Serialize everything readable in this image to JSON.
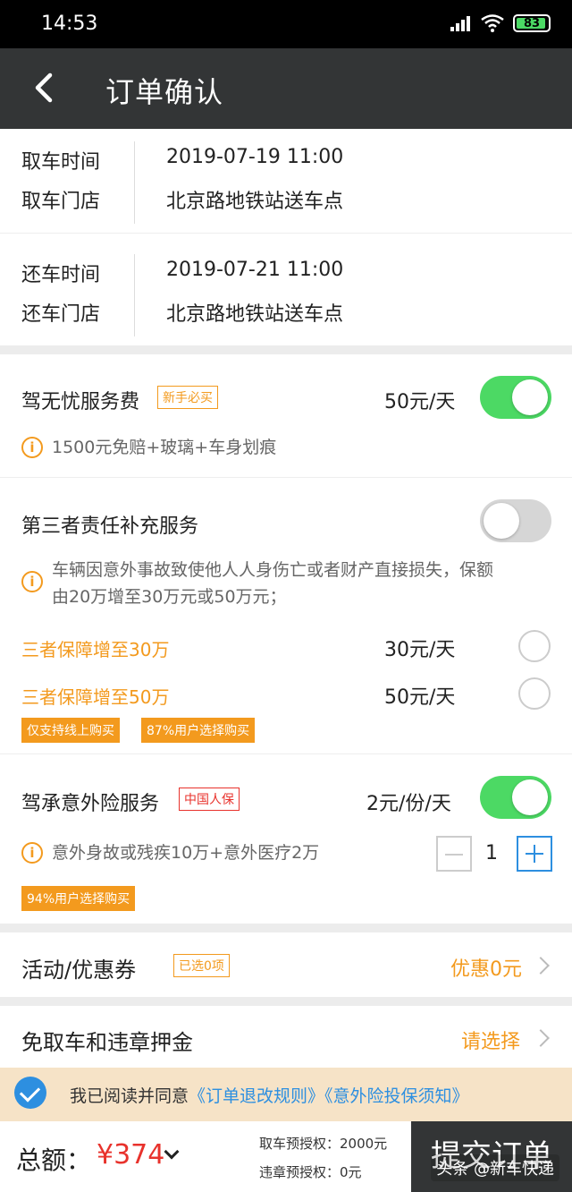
{
  "status_bar": {
    "time": "14:53",
    "battery": "83"
  },
  "nav": {
    "title": "订单确认"
  },
  "pickup": {
    "time_label": "取车时间",
    "time_value": "2019-07-19 11:00",
    "store_label": "取车门店",
    "store_value": "北京路地铁站送车点"
  },
  "return": {
    "time_label": "还车时间",
    "time_value": "2019-07-21 11:00",
    "store_label": "还车门店",
    "store_value": "北京路地铁站送车点"
  },
  "worry_free": {
    "title": "驾无忧服务费",
    "tag": "新手必买",
    "price": "50元/天",
    "enabled": true,
    "note": "1500元免赔+玻璃+车身划痕"
  },
  "third_party": {
    "title": "第三者责任补充服务",
    "enabled": false,
    "note_line1": "车辆因意外事故致使他人人身伤亡或者财产直接损失，保额",
    "note_line2": "由20万增至30万元或50万元；",
    "options": [
      {
        "label": "三者保障增至30万",
        "price": "30元/天",
        "selected": false
      },
      {
        "label": "三者保障增至50万",
        "price": "50元/天",
        "selected": false
      }
    ],
    "badges": [
      "仅支持线上购买",
      "87%用户选择购买"
    ]
  },
  "accident": {
    "title": "驾承意外险服务",
    "tag": "中国人保",
    "price": "2元/份/天",
    "enabled": true,
    "note": "意外身故或残疾10万+意外医疗2万",
    "quantity": "1",
    "badge": "94%用户选择购买"
  },
  "coupon": {
    "label": "活动/优惠券",
    "tag": "已选0项",
    "value": "优惠0元"
  },
  "deposit": {
    "label": "免取车和违章押金",
    "value": "请选择"
  },
  "agreement": {
    "text": "我已阅读并同意",
    "link1": "《订单退改规则》",
    "link2": "《意外险投保须知》",
    "checked": true
  },
  "footer": {
    "total_label": "总额：",
    "total_value": "¥374",
    "pickup_auth": "取车预授权：2000元",
    "violation_auth": "违章预授权：0元",
    "submit": "提交订单",
    "watermark": "头条 @新车快递"
  },
  "colors": {
    "accent_orange": "#f39a1e",
    "price_red": "#e8322c",
    "toggle_on": "#4cd964",
    "link_blue": "#2d8fe0",
    "dark": "#333536"
  }
}
